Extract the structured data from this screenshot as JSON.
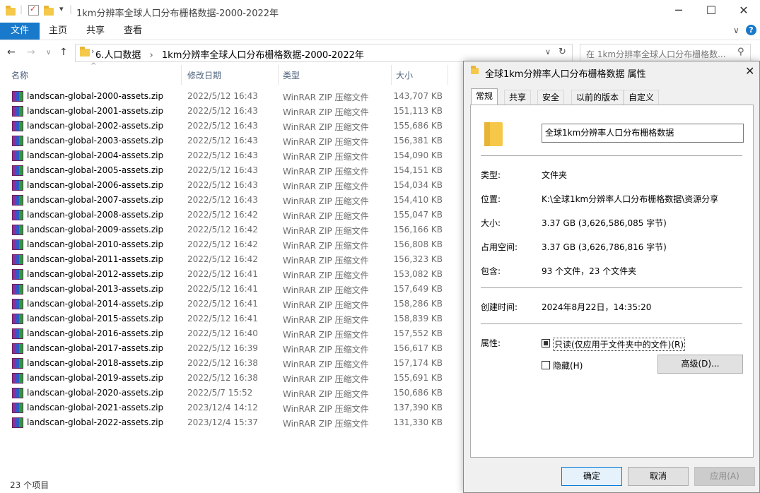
{
  "window": {
    "title": "1km分辨率全球人口分布栅格数据-2000-2022年",
    "minimize": "─",
    "maximize": "☐",
    "close": "✕"
  },
  "ribbon": {
    "tabs": [
      "文件",
      "主页",
      "共享",
      "查看"
    ],
    "chevron": "∨",
    "help": "?"
  },
  "address": {
    "breadcrumb": [
      "6.人口数据",
      "1km分辨率全球人口分布栅格数据-2000-2022年"
    ],
    "search_placeholder": "在 1km分辨率全球人口分布栅格数..."
  },
  "columns": {
    "name": "名称",
    "date": "修改日期",
    "type": "类型",
    "size": "大小"
  },
  "files": [
    {
      "name": "landscan-global-2000-assets.zip",
      "date": "2022/5/12 16:43",
      "type": "WinRAR ZIP 压缩文件",
      "size": "143,707 KB"
    },
    {
      "name": "landscan-global-2001-assets.zip",
      "date": "2022/5/12 16:43",
      "type": "WinRAR ZIP 压缩文件",
      "size": "151,113 KB"
    },
    {
      "name": "landscan-global-2002-assets.zip",
      "date": "2022/5/12 16:43",
      "type": "WinRAR ZIP 压缩文件",
      "size": "155,686 KB"
    },
    {
      "name": "landscan-global-2003-assets.zip",
      "date": "2022/5/12 16:43",
      "type": "WinRAR ZIP 压缩文件",
      "size": "156,381 KB"
    },
    {
      "name": "landscan-global-2004-assets.zip",
      "date": "2022/5/12 16:43",
      "type": "WinRAR ZIP 压缩文件",
      "size": "154,090 KB"
    },
    {
      "name": "landscan-global-2005-assets.zip",
      "date": "2022/5/12 16:43",
      "type": "WinRAR ZIP 压缩文件",
      "size": "154,151 KB"
    },
    {
      "name": "landscan-global-2006-assets.zip",
      "date": "2022/5/12 16:43",
      "type": "WinRAR ZIP 压缩文件",
      "size": "154,034 KB"
    },
    {
      "name": "landscan-global-2007-assets.zip",
      "date": "2022/5/12 16:43",
      "type": "WinRAR ZIP 压缩文件",
      "size": "154,410 KB"
    },
    {
      "name": "landscan-global-2008-assets.zip",
      "date": "2022/5/12 16:42",
      "type": "WinRAR ZIP 压缩文件",
      "size": "155,047 KB"
    },
    {
      "name": "landscan-global-2009-assets.zip",
      "date": "2022/5/12 16:42",
      "type": "WinRAR ZIP 压缩文件",
      "size": "156,166 KB"
    },
    {
      "name": "landscan-global-2010-assets.zip",
      "date": "2022/5/12 16:42",
      "type": "WinRAR ZIP 压缩文件",
      "size": "156,808 KB"
    },
    {
      "name": "landscan-global-2011-assets.zip",
      "date": "2022/5/12 16:42",
      "type": "WinRAR ZIP 压缩文件",
      "size": "156,323 KB"
    },
    {
      "name": "landscan-global-2012-assets.zip",
      "date": "2022/5/12 16:41",
      "type": "WinRAR ZIP 压缩文件",
      "size": "153,082 KB"
    },
    {
      "name": "landscan-global-2013-assets.zip",
      "date": "2022/5/12 16:41",
      "type": "WinRAR ZIP 压缩文件",
      "size": "157,649 KB"
    },
    {
      "name": "landscan-global-2014-assets.zip",
      "date": "2022/5/12 16:41",
      "type": "WinRAR ZIP 压缩文件",
      "size": "158,286 KB"
    },
    {
      "name": "landscan-global-2015-assets.zip",
      "date": "2022/5/12 16:41",
      "type": "WinRAR ZIP 压缩文件",
      "size": "158,839 KB"
    },
    {
      "name": "landscan-global-2016-assets.zip",
      "date": "2022/5/12 16:40",
      "type": "WinRAR ZIP 压缩文件",
      "size": "157,552 KB"
    },
    {
      "name": "landscan-global-2017-assets.zip",
      "date": "2022/5/12 16:39",
      "type": "WinRAR ZIP 压缩文件",
      "size": "156,617 KB"
    },
    {
      "name": "landscan-global-2018-assets.zip",
      "date": "2022/5/12 16:38",
      "type": "WinRAR ZIP 压缩文件",
      "size": "157,174 KB"
    },
    {
      "name": "landscan-global-2019-assets.zip",
      "date": "2022/5/12 16:38",
      "type": "WinRAR ZIP 压缩文件",
      "size": "155,691 KB"
    },
    {
      "name": "landscan-global-2020-assets.zip",
      "date": "2022/5/7 15:52",
      "type": "WinRAR ZIP 压缩文件",
      "size": "150,686 KB"
    },
    {
      "name": "landscan-global-2021-assets.zip",
      "date": "2023/12/4 14:12",
      "type": "WinRAR ZIP 压缩文件",
      "size": "137,390 KB"
    },
    {
      "name": "landscan-global-2022-assets.zip",
      "date": "2023/12/4 15:37",
      "type": "WinRAR ZIP 压缩文件",
      "size": "131,330 KB"
    }
  ],
  "status": "23 个项目",
  "dialog": {
    "title": "全球1km分辨率人口分布栅格数据 属性",
    "tabs": [
      "常规",
      "共享",
      "安全",
      "以前的版本",
      "自定义"
    ],
    "folder_name": "全球1km分辨率人口分布栅格数据",
    "fields": {
      "type_label": "类型:",
      "type_value": "文件夹",
      "location_label": "位置:",
      "location_value": "K:\\全球1km分辨率人口分布栅格数据\\资源分享",
      "size_label": "大小:",
      "size_value": "3.37 GB (3,626,586,085 字节)",
      "disk_label": "占用空间:",
      "disk_value": "3.37 GB (3,626,786,816 字节)",
      "contains_label": "包含:",
      "contains_value": "93 个文件，23 个文件夹",
      "created_label": "创建时间:",
      "created_value": "2024年8月22日，14:35:20",
      "attr_label": "属性:"
    },
    "readonly_label": "只读(仅应用于文件夹中的文件)(R)",
    "hidden_label": "隐藏(H)",
    "advanced_button": "高级(D)...",
    "ok": "确定",
    "cancel": "取消",
    "apply": "应用(A)"
  }
}
